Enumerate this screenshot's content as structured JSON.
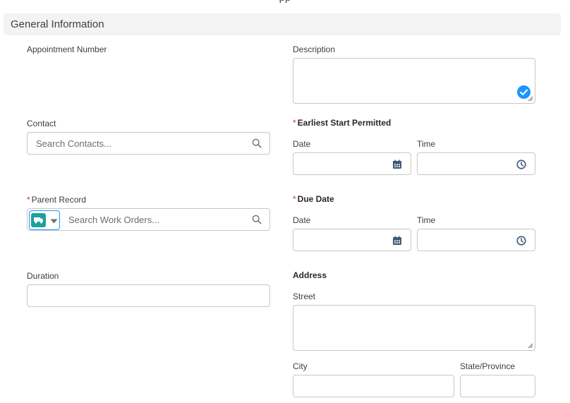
{
  "top_text": "pp",
  "section": {
    "title": "General Information"
  },
  "fields": {
    "appointment_number": {
      "label": "Appointment Number"
    },
    "description": {
      "label": "Description",
      "value": ""
    },
    "contact": {
      "label": "Contact",
      "placeholder": "Search Contacts..."
    },
    "earliest_start": {
      "required_mark": "*",
      "label": "Earliest Start Permitted",
      "date_label": "Date",
      "time_label": "Time"
    },
    "parent_record": {
      "required_mark": "*",
      "label": "Parent Record",
      "placeholder": "Search Work Orders..."
    },
    "due_date": {
      "required_mark": "*",
      "label": "Due Date",
      "date_label": "Date",
      "time_label": "Time"
    },
    "duration": {
      "label": "Duration",
      "value": ""
    },
    "address": {
      "label": "Address",
      "street_label": "Street",
      "city_label": "City",
      "state_label": "State/Province"
    }
  },
  "icons": {
    "search": "search-icon",
    "calendar": "calendar-icon",
    "clock": "clock-icon",
    "check": "check-icon",
    "truck": "truck-icon",
    "dropdown": "chevron-down-icon"
  },
  "colors": {
    "accent": "#1b96ff",
    "required": "#c23934",
    "chip": "#20a09a",
    "icon": "#3e5a7a"
  }
}
